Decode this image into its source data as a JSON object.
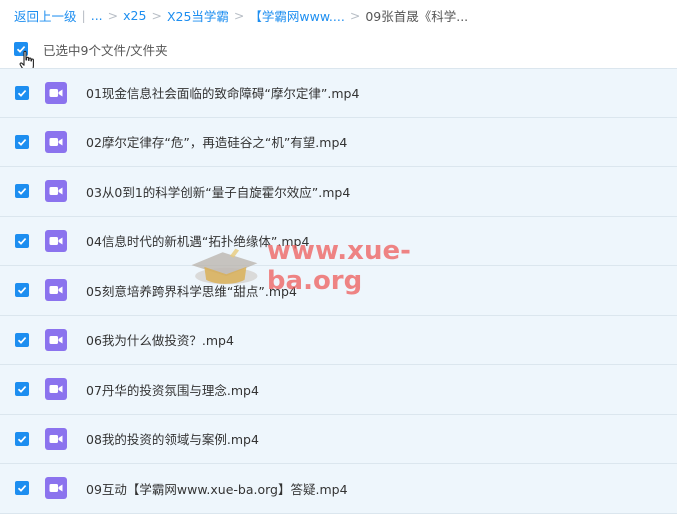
{
  "breadcrumb": {
    "back": "返回上一级",
    "ellipsis": "...",
    "items": [
      "x25",
      "X25当学霸",
      "【学霸网www....",
      "09张首晟《科学..."
    ]
  },
  "selection": {
    "label": "已选中9个文件/文件夹"
  },
  "files": [
    {
      "name": "01现金信息社会面临的致命障碍“摩尔定律”.mp4"
    },
    {
      "name": "02摩尔定律存“危”，再造硅谷之“机”有望.mp4"
    },
    {
      "name": "03从0到1的科学创新“量子自旋霍尔效应”.mp4"
    },
    {
      "name": "04信息时代的新机遇“拓扑绝缘体”.mp4"
    },
    {
      "name": "05刻意培养跨界科学思维“甜点”.mp4"
    },
    {
      "name": "06我为什么做投资？.mp4"
    },
    {
      "name": "07丹华的投资氛围与理念.mp4"
    },
    {
      "name": "08我的投资的领域与案例.mp4"
    },
    {
      "name": "09互动【学霸网www.xue-ba.org】答疑.mp4"
    }
  ],
  "watermark": {
    "text": "www.xue-ba.org"
  },
  "colors": {
    "accent": "#1d8ef0",
    "video_icon": "#8b73ee",
    "row_selected": "#eef6fc",
    "watermark": "#ef5d5b"
  }
}
